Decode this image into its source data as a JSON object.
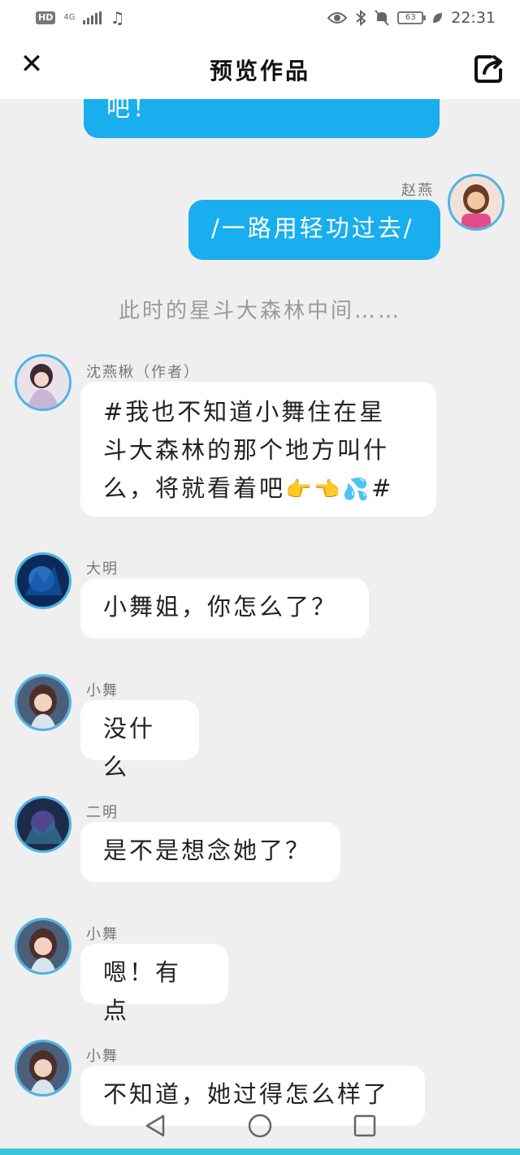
{
  "status_bar": {
    "hd": "HD",
    "network": "4G",
    "battery": "63",
    "time": "22:31"
  },
  "header": {
    "title": "预览作品"
  },
  "messages": [
    {
      "side": "right",
      "text": "吧！"
    },
    {
      "side": "right",
      "sender": "赵燕",
      "text": "/一路用轻功过去/"
    },
    {
      "type": "narration",
      "text": "此时的星斗大森林中间……"
    },
    {
      "side": "left",
      "sender": "沈燕楸（作者）",
      "lines": [
        "#我也不知道小舞住在星",
        "斗大森林的那个地方叫什",
        "么，将就看着吧"
      ],
      "emoji": "👉👈💦",
      "suffix": "#"
    },
    {
      "side": "left",
      "sender": "大明",
      "text": "小舞姐，你怎么了？"
    },
    {
      "side": "left",
      "sender": "小舞",
      "text": "没什么"
    },
    {
      "side": "left",
      "sender": "二明",
      "text": "是不是想念她了？"
    },
    {
      "side": "left",
      "sender": "小舞",
      "text": "嗯！有点"
    },
    {
      "side": "left",
      "sender": "小舞",
      "text": "不知道，她过得怎么样了"
    }
  ],
  "colors": {
    "accent_blue": "#19aeee",
    "avatar_ring": "#4fb4e6",
    "background": "#efeff0"
  },
  "icons": [
    "close-icon",
    "share-icon",
    "back-icon",
    "home-icon",
    "recents-icon",
    "eye-icon",
    "bluetooth-icon",
    "mute-icon",
    "leaf-icon",
    "music-icon"
  ]
}
